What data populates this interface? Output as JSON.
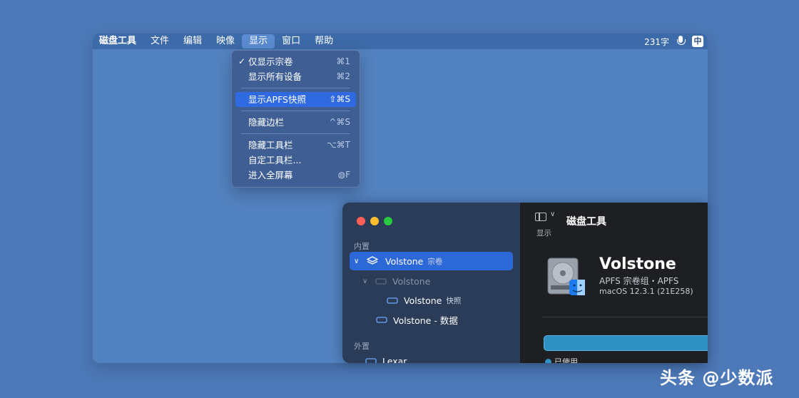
{
  "menubar": {
    "app_name": "磁盘工具",
    "items": [
      "文件",
      "编辑",
      "映像",
      "显示",
      "窗口",
      "帮助"
    ],
    "word_count": "231字",
    "ime_label": "中"
  },
  "view_menu": {
    "items": [
      {
        "label": "仅显示宗卷",
        "shortcut": "⌘1",
        "checked": "✓"
      },
      {
        "label": "显示所有设备",
        "shortcut": "⌘2"
      },
      {
        "label": "显示APFS快照",
        "shortcut": "⇧⌘S"
      },
      {
        "label": "隐藏边栏",
        "shortcut": "^⌘S"
      },
      {
        "label": "隐藏工具栏",
        "shortcut": "⌥⌘T"
      },
      {
        "label": "自定工具栏...",
        "shortcut": ""
      },
      {
        "label": "进入全屏幕",
        "shortcut": "◍F"
      }
    ]
  },
  "window": {
    "sidebar": {
      "internal_label": "内置",
      "external_label": "外置",
      "items": [
        {
          "name": "Volstone",
          "sub": "宗卷"
        },
        {
          "name": "Volstone",
          "sub": ""
        },
        {
          "name": "Volstone",
          "sub": "快照"
        },
        {
          "name": "Volstone - 数据",
          "sub": ""
        },
        {
          "name": "Lexar",
          "sub": ""
        }
      ]
    },
    "toolbar": {
      "view_label": "显示",
      "title": "磁盘工具"
    },
    "volume": {
      "name": "Volstone",
      "type": "APFS 宗卷组・APFS",
      "os": "macOS 12.3.1 (21E258)",
      "used_label": "已使用"
    }
  },
  "watermark": "头条 @少数派",
  "colors": {
    "desktop": "#4d79b9",
    "selection": "#2d68d8",
    "usage_bar": "#2e90c3"
  }
}
